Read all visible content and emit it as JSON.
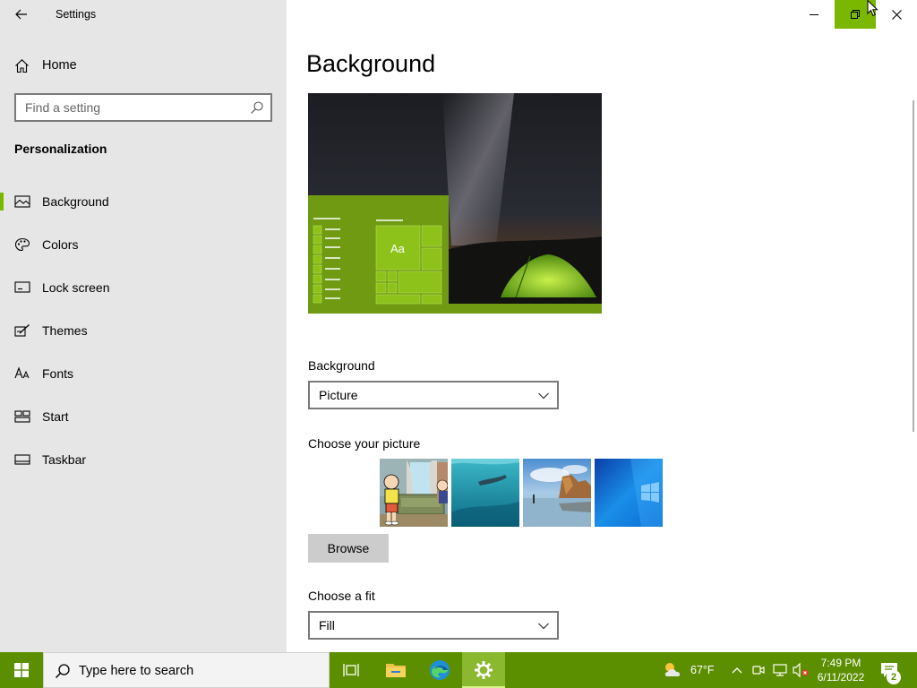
{
  "window": {
    "title": "Settings",
    "controls": [
      "minimize",
      "restore",
      "close"
    ],
    "accent_color": "#7ab800"
  },
  "sidebar": {
    "home_label": "Home",
    "search_placeholder": "Find a setting",
    "section_title": "Personalization",
    "items": [
      {
        "label": "Background",
        "icon": "picture-icon",
        "active": true
      },
      {
        "label": "Colors",
        "icon": "palette-icon",
        "active": false
      },
      {
        "label": "Lock screen",
        "icon": "lock-screen-icon",
        "active": false
      },
      {
        "label": "Themes",
        "icon": "brush-icon",
        "active": false
      },
      {
        "label": "Fonts",
        "icon": "fonts-icon",
        "active": false
      },
      {
        "label": "Start",
        "icon": "start-icon",
        "active": false
      },
      {
        "label": "Taskbar",
        "icon": "taskbar-icon",
        "active": false
      }
    ]
  },
  "main": {
    "page_title": "Background",
    "preview": {
      "sample_text": "Aa"
    },
    "background_label": "Background",
    "background_value": "Picture",
    "choose_picture_label": "Choose your picture",
    "pictures": [
      "cartoon-living-room",
      "underwater-swimmer",
      "beach-rocks",
      "windows-10-default"
    ],
    "browse_label": "Browse",
    "fit_label": "Choose a fit",
    "fit_value": "Fill"
  },
  "taskbar": {
    "search_text": "Type here to search",
    "pinned": [
      "task-view",
      "file-explorer",
      "edge",
      "settings"
    ],
    "active_app": "settings",
    "weather": "67°F",
    "time": "7:49 PM",
    "date": "6/11/2022",
    "notification_count": "2",
    "color": "#5c8f00"
  }
}
